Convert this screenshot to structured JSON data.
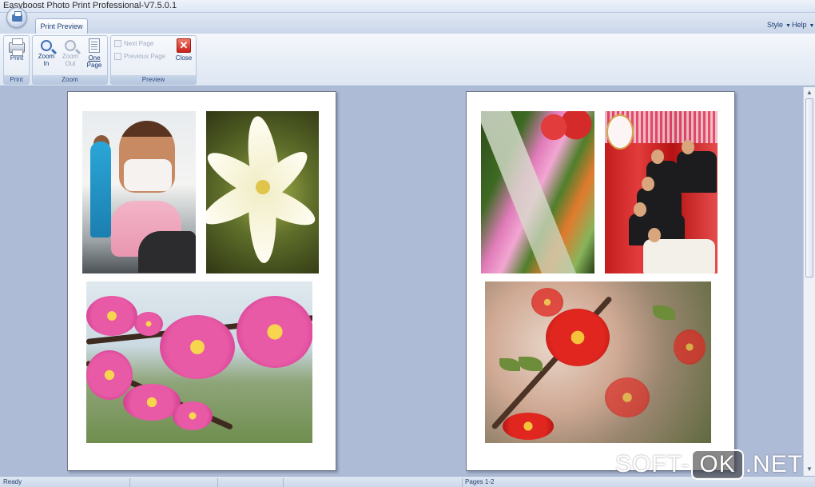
{
  "window": {
    "title": "Easyboost Photo Print Professional-V7.5.0.1"
  },
  "tabs": {
    "active_label": "Print Preview"
  },
  "menu": {
    "style_label": "Style",
    "help_label": "Help"
  },
  "ribbon": {
    "print_group": {
      "label": "Print",
      "print_button": "Print"
    },
    "zoom_group": {
      "label": "Zoom",
      "zoom_in_line1": "Zoom",
      "zoom_in_line2": "In",
      "zoom_out_line1": "Zoom",
      "zoom_out_line2": "Out",
      "one_page_line1": "One",
      "one_page_line2": "Page"
    },
    "preview_group": {
      "label": "Preview",
      "next_page": "Next Page",
      "previous_page": "Previous Page",
      "close": "Close",
      "close_glyph": "✕"
    }
  },
  "pages": [
    {
      "photos": [
        "fitness-woman",
        "white-lily",
        "pink-blossom-branch"
      ]
    },
    {
      "photos": [
        "flower-garden",
        "group-photo-red",
        "red-quince-blossom"
      ]
    }
  ],
  "status": {
    "ready": "Ready",
    "pages": "Pages 1-2"
  },
  "watermark": {
    "left": "SOFT-",
    "box": "OK",
    "right": ".NET"
  },
  "icons": {
    "print": "printer-icon",
    "zoom_in": "zoom-in-icon",
    "zoom_out": "zoom-out-icon",
    "one_page": "one-page-icon",
    "next_page": "next-page-icon",
    "previous_page": "previous-page-icon",
    "close": "close-icon"
  },
  "colors": {
    "workspace": "#aebbd6",
    "close_button": "#c9221a",
    "ribbon_text": "#153a75"
  }
}
